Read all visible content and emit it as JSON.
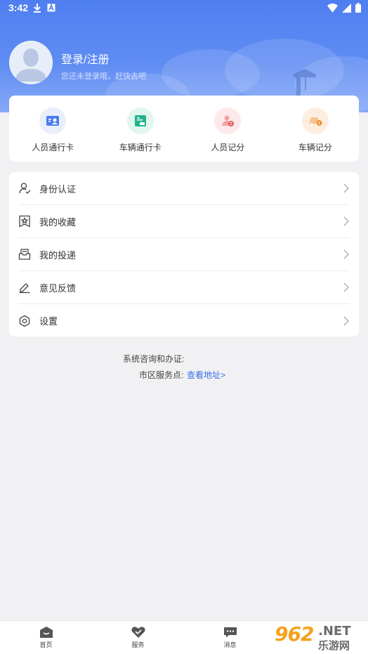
{
  "status_bar": {
    "time": "3:42",
    "icons": [
      "download-icon",
      "font-a-icon",
      "wifi-icon",
      "signal-icon",
      "battery-icon"
    ]
  },
  "user": {
    "login_title": "登录/注册",
    "login_subtitle": "您还未登录哦，赶快去吧"
  },
  "quick_actions": [
    {
      "label": "人员通行卡",
      "icon": "person-card-icon",
      "color": "#4a7cf0",
      "bg": "#e9eefc"
    },
    {
      "label": "车辆通行卡",
      "icon": "vehicle-card-icon",
      "color": "#21b38f",
      "bg": "#e2f5ef"
    },
    {
      "label": "人员记分",
      "icon": "person-score-icon",
      "color": "#e35d5d",
      "bg": "#fde9e9"
    },
    {
      "label": "车辆记分",
      "icon": "car-score-icon",
      "color": "#f08a2e",
      "bg": "#fdeedf"
    }
  ],
  "menu": [
    {
      "label": "身份认证",
      "icon": "user-verify-icon"
    },
    {
      "label": "我的收藏",
      "icon": "bookmark-star-icon"
    },
    {
      "label": "我的投递",
      "icon": "inbox-icon"
    },
    {
      "label": "意见反馈",
      "icon": "pencil-icon"
    },
    {
      "label": "设置",
      "icon": "gear-icon"
    }
  ],
  "info": {
    "line1": "系统咨询和办证:",
    "line2_label": "市区服务点:",
    "line2_link": "查看地址>"
  },
  "tabs": [
    {
      "label": "首页",
      "icon": "home-icon"
    },
    {
      "label": "服务",
      "icon": "service-icon"
    },
    {
      "label": "消息",
      "icon": "message-icon"
    },
    {
      "label": "",
      "icon": "profile-icon"
    }
  ],
  "watermark": {
    "number": "962",
    "net": ".NET",
    "cn": "乐游网"
  },
  "colors": {
    "header_blue": "#4f7ef0",
    "link_blue": "#3b6ee8",
    "background": "#f1f1f3"
  }
}
